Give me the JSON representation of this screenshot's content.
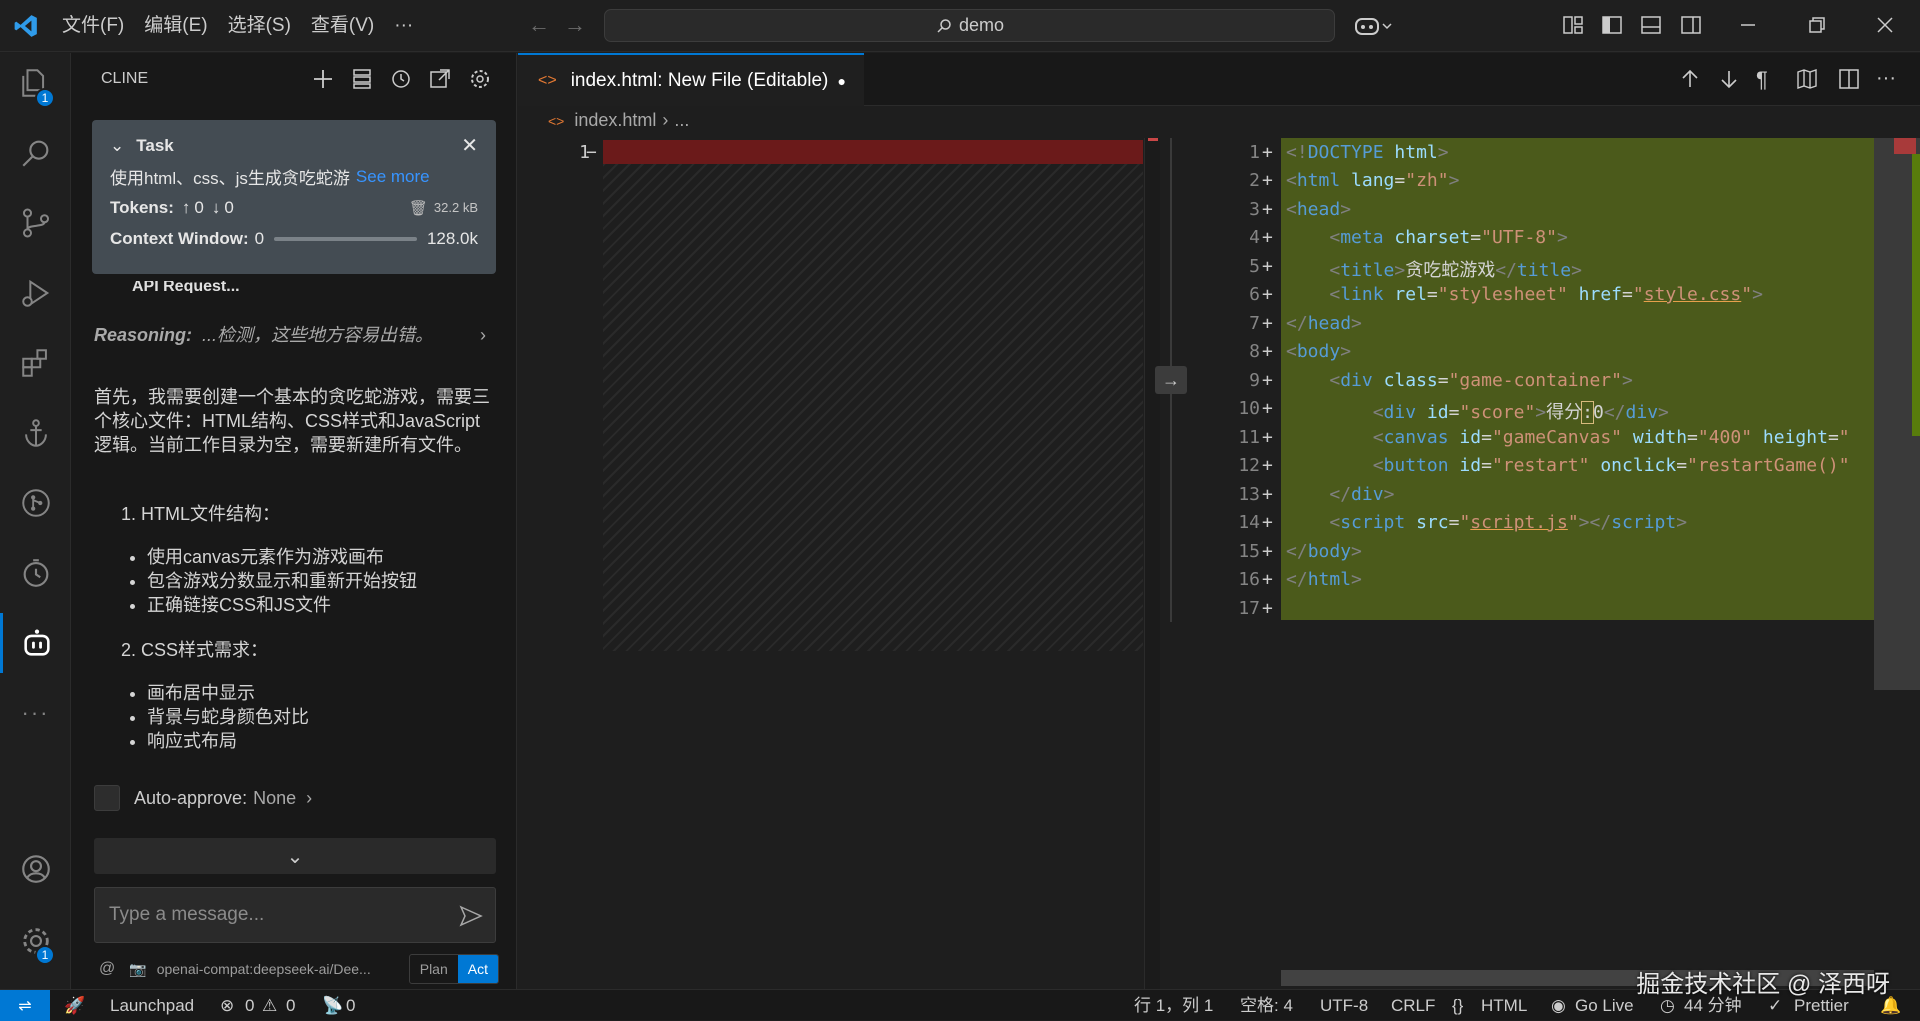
{
  "titlebar": {
    "menus": [
      "文件(F)",
      "编辑(E)",
      "选择(S)",
      "查看(V)",
      "···"
    ],
    "search": "demo"
  },
  "activity": {
    "explorer_badge": "1",
    "settings_badge": "1"
  },
  "sidebar": {
    "title": "CLINE",
    "task": {
      "title": "Task",
      "text": "使用html、css、js生成贪吃蛇游",
      "see_more": "See more",
      "tokens_label": "Tokens:",
      "tokens_up": "0",
      "tokens_down": "0",
      "size": "32.2 kB",
      "context_label": "Context Window:",
      "context_used": "0",
      "context_max": "128.0k"
    },
    "api_request": "API Request...",
    "reasoning_label": "Reasoning:",
    "reasoning_text": "...检测，这些地方容易出错。",
    "paragraph": "首先，我需要创建一个基本的贪吃蛇游戏，需要三个核心文件：HTML结构、CSS样式和JavaScript逻辑。当前工作目录为空，需要新建所有文件。",
    "section1": "1. HTML文件结构：",
    "section1_items": [
      "使用canvas元素作为游戏画布",
      "包含游戏分数显示和重新开始按钮",
      "正确链接CSS和JS文件"
    ],
    "section2": "2. CSS样式需求：",
    "section2_items": [
      "画布居中显示",
      "背景与蛇身颜色对比",
      "响应式布局"
    ],
    "auto_approve_label": "Auto-approve:",
    "auto_approve_value": "None",
    "input_placeholder": "Type a message...",
    "model": "openai-compat:deepseek-ai/Dee...",
    "mode_plan": "Plan",
    "mode_act": "Act"
  },
  "editor": {
    "tab_label": "index.html: New File (Editable)",
    "breadcrumb_file": "index.html",
    "breadcrumb_rest": "...",
    "left_line": "1",
    "lines": [
      "1",
      "2",
      "3",
      "4",
      "5",
      "6",
      "7",
      "8",
      "9",
      "10",
      "11",
      "12",
      "13",
      "14",
      "15",
      "16",
      "17"
    ]
  },
  "statusbar": {
    "launchpad": "Launchpad",
    "errors": "0",
    "warnings": "0",
    "ports": "0",
    "position": "行 1，列 1",
    "spaces": "空格: 4",
    "encoding": "UTF-8",
    "eol": "CRLF",
    "language": "HTML",
    "golive": "Go Live",
    "time": "44 分钟",
    "prettier": "Prettier"
  },
  "watermark": "掘金技术社区 @ 泽西呀",
  "colors": {
    "accent": "#0078d4",
    "added_bg": "#4b5a1b",
    "removed_bg": "#6b1a1a"
  }
}
